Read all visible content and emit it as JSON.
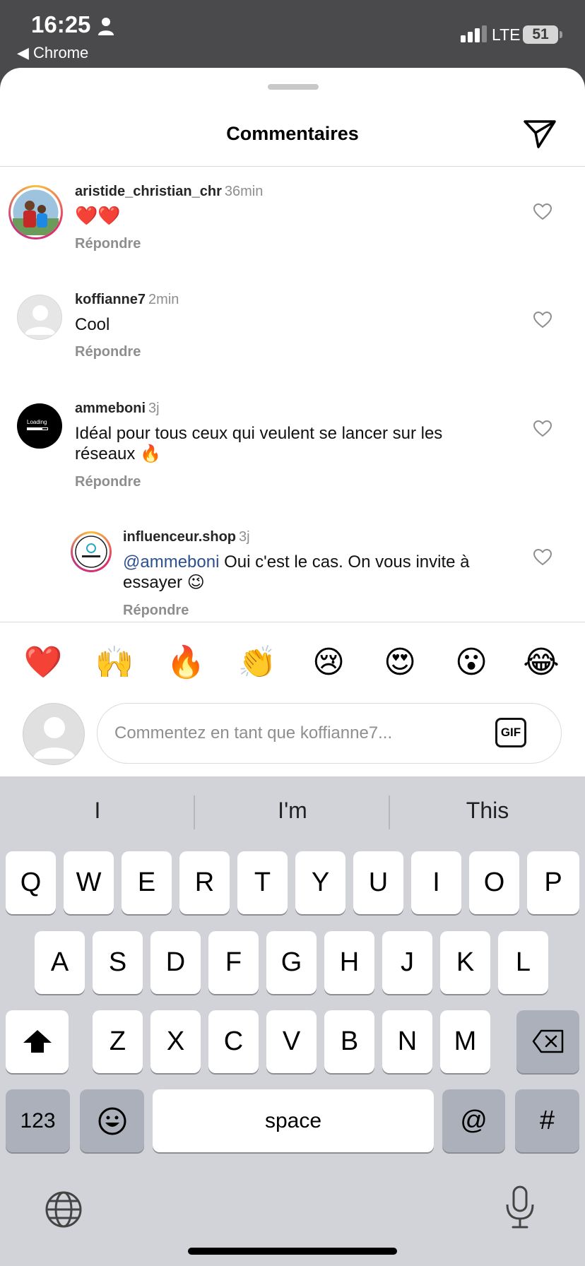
{
  "status_bar": {
    "time": "16:25",
    "back_app": "◀ Chrome",
    "network": "LTE",
    "battery": "51"
  },
  "sheet": {
    "title": "Commentaires"
  },
  "comments": [
    {
      "username": "aristide_christian_chr",
      "time": "36min",
      "text": "❤️❤️",
      "reply": "Répondre"
    },
    {
      "username": "koffianne7",
      "time": "2min",
      "text": "Cool",
      "reply": "Répondre"
    },
    {
      "username": "ammeboni",
      "time": "3j",
      "text": "Idéal pour tous ceux qui veulent se lancer sur les réseaux 🔥",
      "reply": "Répondre",
      "avatar_text": "Loading"
    },
    {
      "username": "influenceur.shop",
      "time": "3j",
      "mention": "@ammeboni",
      "text": " Oui c'est le cas. On vous invite à essayer 😉",
      "reply": "Répondre"
    }
  ],
  "emoji_bar": [
    "❤️",
    "🙌",
    "🔥",
    "👏",
    "😢",
    "😍",
    "😮",
    "😂"
  ],
  "input": {
    "placeholder": "Commentez en tant que koffianne7...",
    "gif_label": "GIF"
  },
  "keyboard": {
    "suggestions": [
      "I",
      "I'm",
      "This"
    ],
    "row1": [
      "Q",
      "W",
      "E",
      "R",
      "T",
      "Y",
      "U",
      "I",
      "O",
      "P"
    ],
    "row2": [
      "A",
      "S",
      "D",
      "F",
      "G",
      "H",
      "J",
      "K",
      "L"
    ],
    "row3": [
      "Z",
      "X",
      "C",
      "V",
      "B",
      "N",
      "M"
    ],
    "numbers_label": "123",
    "space_label": "space",
    "at_label": "@",
    "hash_label": "#"
  }
}
